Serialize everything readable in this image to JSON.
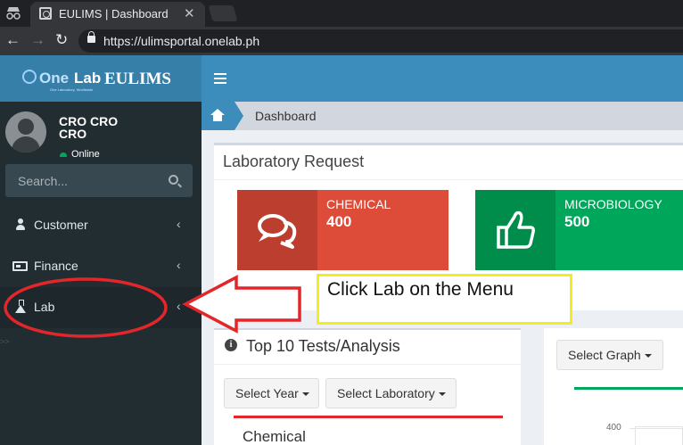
{
  "browser": {
    "tab_title": "EULIMS | Dashboard",
    "tab_close": "✕",
    "url": "https://ulimsportal.onelab.ph",
    "nav_back": "←",
    "nav_forward": "→",
    "nav_reload": "↻"
  },
  "logo": {
    "one": "One",
    "lab": "Lab",
    "eulims": "EULIMS",
    "tagline": "One Laboratory. Worldwide"
  },
  "user": {
    "name_line1": "CRO CRO",
    "name_line2": "CRO",
    "status": "Online"
  },
  "search": {
    "placeholder": "Search..."
  },
  "menu": {
    "items": [
      {
        "label": "Customer",
        "icon": "user-icon",
        "chevron": "‹"
      },
      {
        "label": "Finance",
        "icon": "finance-icon",
        "chevron": "‹"
      },
      {
        "label": "Lab",
        "icon": "flask-icon",
        "chevron": "‹"
      }
    ],
    "edge_mark": ">>"
  },
  "breadcrumb": {
    "current": "Dashboard"
  },
  "lab_request": {
    "title": "Laboratory Request",
    "boxes": [
      {
        "label": "CHEMICAL",
        "value": "400",
        "color": "#dd4b39",
        "icon": "comments-icon"
      },
      {
        "label": "MICROBIOLOGY",
        "value": "500",
        "color": "#00a65a",
        "icon": "thumbs-up-icon"
      }
    ]
  },
  "top_tests": {
    "info_glyph": "i",
    "title": "Top 10 Tests/Analysis",
    "select_year": "Select Year",
    "select_lab": "Select Laboratory",
    "section_label": "Chemical"
  },
  "graph": {
    "select_graph": "Select Graph",
    "axis_tick": "400"
  },
  "annotation": {
    "text": "Click Lab on the Menu",
    "box_color": "#f6ec1d",
    "arrow_color": "#e3262a"
  }
}
